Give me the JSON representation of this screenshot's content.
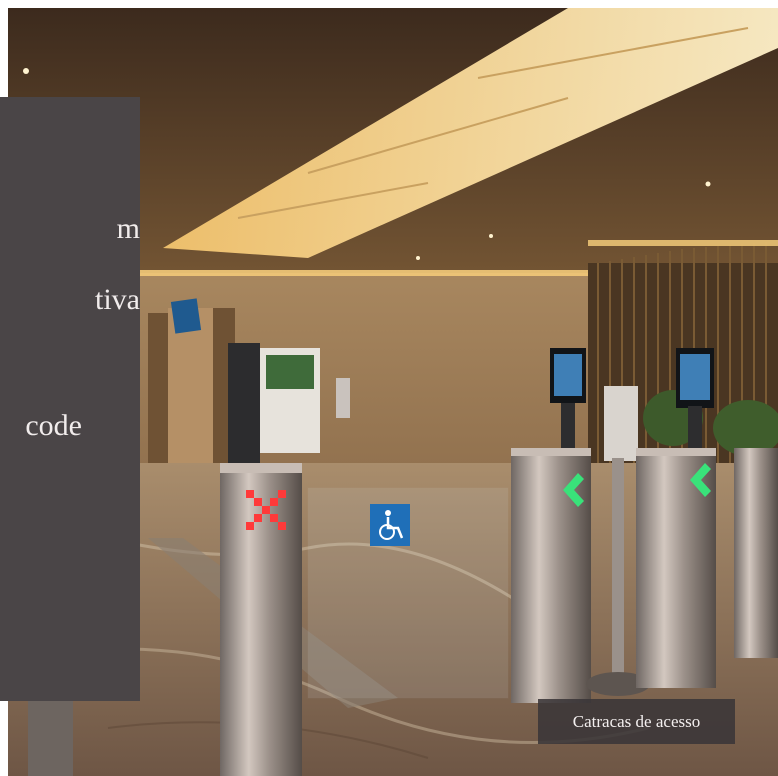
{
  "overlay": {
    "lines": [
      "m",
      "tiva",
      "code"
    ]
  },
  "caption": "Catracas de acesso",
  "colors": {
    "panel": "#4a4547",
    "arrow_green": "#39e27a",
    "cross_red": "#ff3a3a",
    "accessibility_blue": "#1f6fb8",
    "ceiling_light": "#f7d98a"
  }
}
